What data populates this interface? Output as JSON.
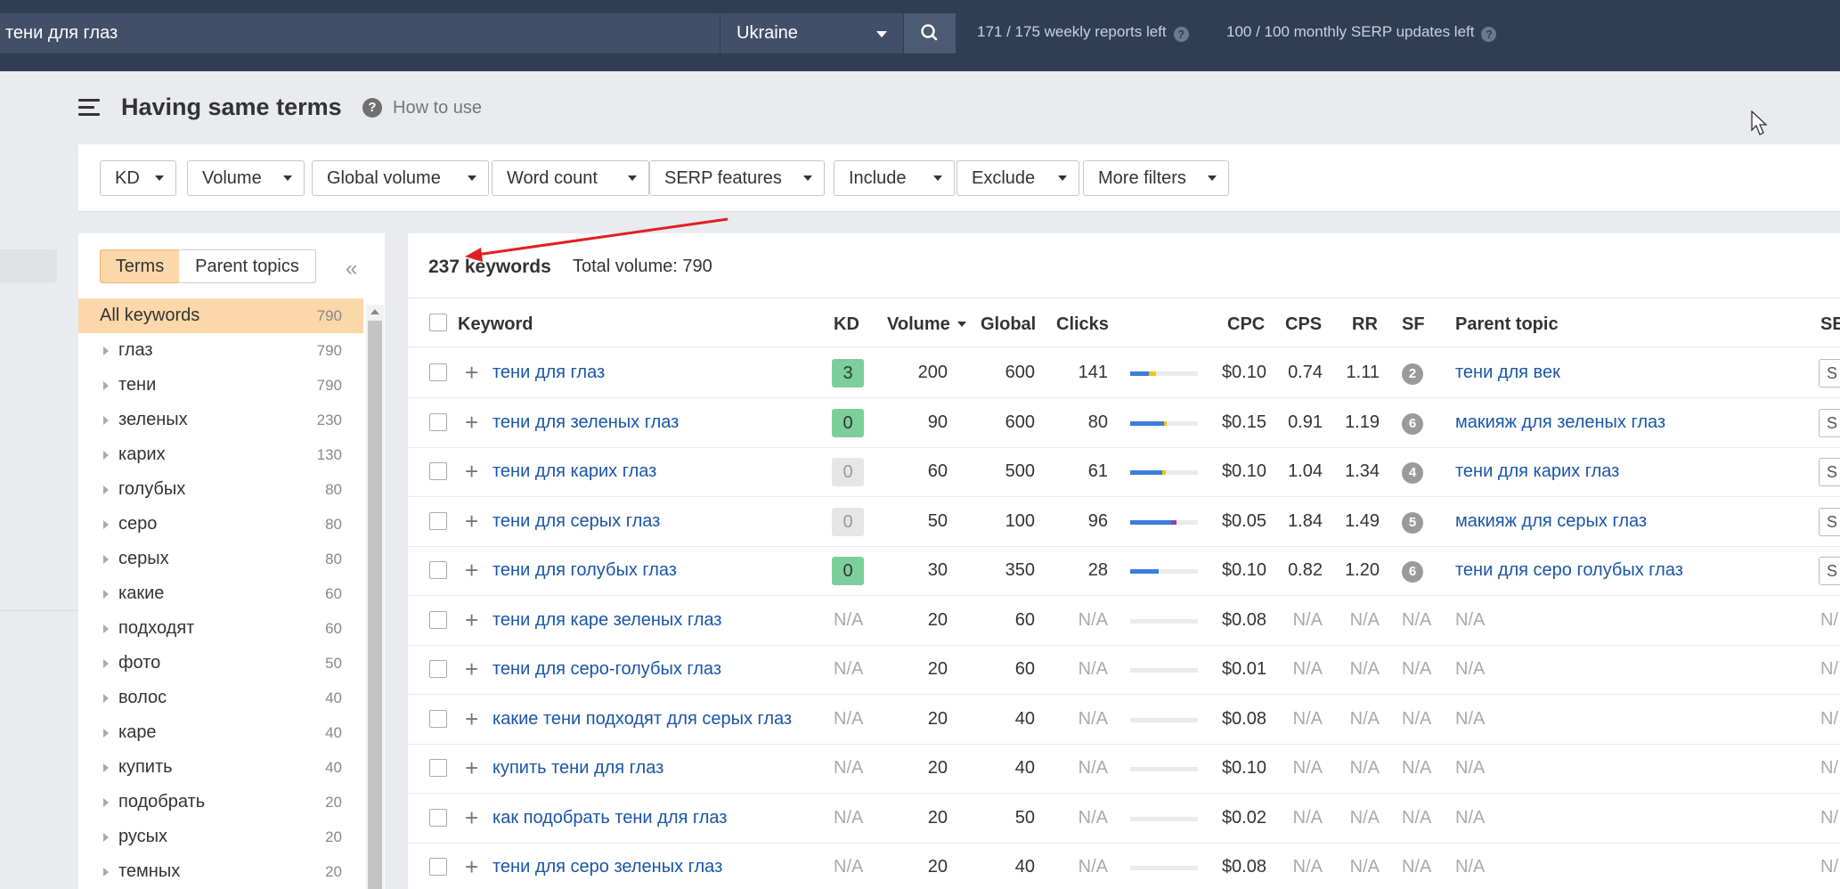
{
  "topbar": {
    "search_value": "тени для глаз",
    "country": "Ukraine",
    "weekly_reports": "171 / 175 weekly reports left",
    "monthly_serp": "100 / 100 monthly SERP updates left",
    "help_glyph": "?"
  },
  "header": {
    "title": "Having same terms",
    "how_to": "How to use",
    "help_glyph": "?"
  },
  "filters": [
    "KD",
    "Volume",
    "Global volume",
    "Word count",
    "SERP features",
    "Include",
    "Exclude",
    "More filters"
  ],
  "sidebar": {
    "tabs": [
      "Terms",
      "Parent topics"
    ],
    "collapse_glyph": "«",
    "items": [
      {
        "label": "All keywords",
        "count": "790"
      },
      {
        "label": "глаз",
        "count": "790"
      },
      {
        "label": "тени",
        "count": "790"
      },
      {
        "label": "зеленых",
        "count": "230"
      },
      {
        "label": "карих",
        "count": "130"
      },
      {
        "label": "голубых",
        "count": "80"
      },
      {
        "label": "серо",
        "count": "80"
      },
      {
        "label": "серых",
        "count": "80"
      },
      {
        "label": "какие",
        "count": "60"
      },
      {
        "label": "подходят",
        "count": "60"
      },
      {
        "label": "фото",
        "count": "50"
      },
      {
        "label": "волос",
        "count": "40"
      },
      {
        "label": "каре",
        "count": "40"
      },
      {
        "label": "купить",
        "count": "40"
      },
      {
        "label": "подобрать",
        "count": "20"
      },
      {
        "label": "русых",
        "count": "20"
      },
      {
        "label": "темных",
        "count": "20"
      }
    ]
  },
  "summary": {
    "keywords": "237 keywords",
    "total_volume": "Total volume: 790"
  },
  "table": {
    "headers": {
      "keyword": "Keyword",
      "kd": "KD",
      "volume": "Volume",
      "global": "Global",
      "clicks": "Clicks",
      "cpc": "CPC",
      "cps": "CPS",
      "rr": "RR",
      "sf": "SF",
      "parent": "Parent topic",
      "se": "SE"
    },
    "plus_glyph": "+",
    "rows": [
      {
        "keyword": "тени для глаз",
        "kd": "3",
        "kd_color": "#7ccf9a",
        "volume": "200",
        "global": "600",
        "clicks": "141",
        "clicks_bar": [
          0.28,
          0.1,
          0.62
        ],
        "cpc": "$0.10",
        "cps": "0.74",
        "rr": "1.11",
        "sf": "2",
        "parent": "тени для век",
        "se": "S"
      },
      {
        "keyword": "тени для зеленых глаз",
        "kd": "0",
        "kd_color": "#7ccf9a",
        "volume": "90",
        "global": "600",
        "clicks": "80",
        "clicks_bar": [
          0.5,
          0.04,
          0.46
        ],
        "cpc": "$0.15",
        "cps": "0.91",
        "rr": "1.19",
        "sf": "6",
        "parent": "макияж для зеленых глаз",
        "se": "S"
      },
      {
        "keyword": "тени для карих глаз",
        "kd": "0",
        "kd_color": "#e6e6e6",
        "volume": "60",
        "global": "500",
        "clicks": "61",
        "clicks_bar": [
          0.48,
          0.04,
          0.48
        ],
        "cpc": "$0.10",
        "cps": "1.04",
        "rr": "1.34",
        "sf": "4",
        "parent": "тени для карих глаз",
        "se": "S"
      },
      {
        "keyword": "тени для серых глаз",
        "kd": "0",
        "kd_color": "#e6e6e6",
        "volume": "50",
        "global": "100",
        "clicks": "96",
        "clicks_bar": [
          0.6,
          0.08,
          0.32
        ],
        "cpc": "$0.05",
        "cps": "1.84",
        "rr": "1.49",
        "sf": "5",
        "parent": "макияж для серых глаз",
        "se": "S"
      },
      {
        "keyword": "тени для голубых глаз",
        "kd": "0",
        "kd_color": "#7ccf9a",
        "volume": "30",
        "global": "350",
        "clicks": "28",
        "clicks_bar": [
          0.42,
          0.0,
          0.58
        ],
        "cpc": "$0.10",
        "cps": "0.82",
        "rr": "1.20",
        "sf": "6",
        "parent": "тени для серо голубых глаз",
        "se": "S"
      },
      {
        "keyword": "тени для каре зеленых глаз",
        "kd": "N/A",
        "volume": "20",
        "global": "60",
        "clicks": "N/A",
        "cpc": "$0.08",
        "cps": "N/A",
        "rr": "N/A",
        "sf": "N/A",
        "parent": "N/A",
        "se": "N/"
      },
      {
        "keyword": "тени для серо-голубых глаз",
        "kd": "N/A",
        "volume": "20",
        "global": "60",
        "clicks": "N/A",
        "cpc": "$0.01",
        "cps": "N/A",
        "rr": "N/A",
        "sf": "N/A",
        "parent": "N/A",
        "se": "N/"
      },
      {
        "keyword": "какие тени подходят для серых глаз",
        "kd": "N/A",
        "volume": "20",
        "global": "40",
        "clicks": "N/A",
        "cpc": "$0.08",
        "cps": "N/A",
        "rr": "N/A",
        "sf": "N/A",
        "parent": "N/A",
        "se": "N/"
      },
      {
        "keyword": "купить тени для глаз",
        "kd": "N/A",
        "volume": "20",
        "global": "40",
        "clicks": "N/A",
        "cpc": "$0.10",
        "cps": "N/A",
        "rr": "N/A",
        "sf": "N/A",
        "parent": "N/A",
        "se": "N/"
      },
      {
        "keyword": "как подобрать тени для глаз",
        "kd": "N/A",
        "volume": "20",
        "global": "50",
        "clicks": "N/A",
        "cpc": "$0.02",
        "cps": "N/A",
        "rr": "N/A",
        "sf": "N/A",
        "parent": "N/A",
        "se": "N/"
      },
      {
        "keyword": "тени для серо зеленых глаз",
        "kd": "N/A",
        "volume": "20",
        "global": "40",
        "clicks": "N/A",
        "cpc": "$0.08",
        "cps": "N/A",
        "rr": "N/A",
        "sf": "N/A",
        "parent": "N/A",
        "se": "N/"
      }
    ]
  },
  "colors": {
    "topbar": "#2f3e55",
    "link": "#1a55a8",
    "kd_easy": "#7ccf9a",
    "active_tab": "#fbd7a9",
    "annotation_arrow": "#e02020",
    "bar_blue": "#3b7ddd",
    "bar_yellow": "#f5c400",
    "bar_purple": "#8e44ad"
  }
}
